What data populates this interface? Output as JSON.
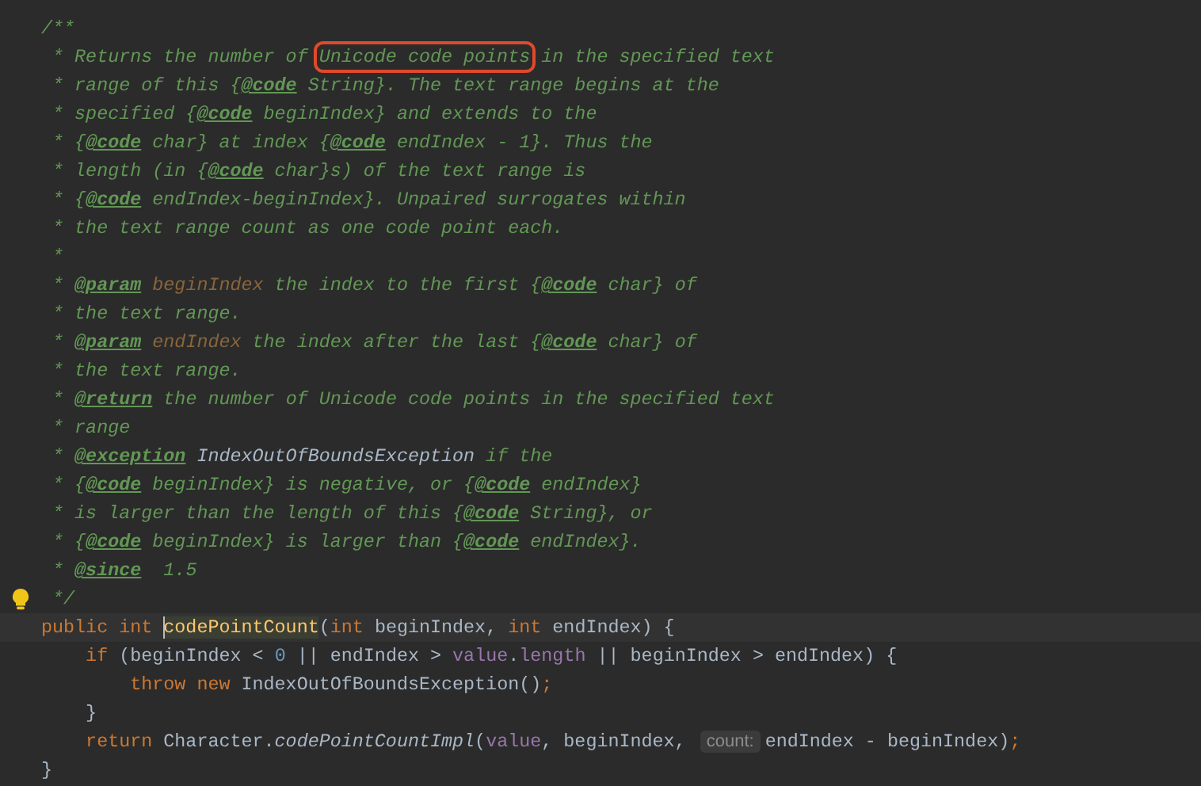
{
  "editor": {
    "lines": [
      {
        "tokens": [
          {
            "kind": "comment",
            "text": "/**"
          }
        ]
      },
      {
        "tokens": [
          {
            "kind": "comment",
            "text": " * Returns the number of "
          },
          {
            "kind": "comment",
            "text": "Unicode code points",
            "boxed": true
          },
          {
            "kind": "comment",
            "text": " in the specified text"
          }
        ]
      },
      {
        "tokens": [
          {
            "kind": "comment",
            "text": " * range of this {"
          },
          {
            "kind": "tag",
            "text": "@code"
          },
          {
            "kind": "comment",
            "text": " String}. The text range begins at the"
          }
        ]
      },
      {
        "tokens": [
          {
            "kind": "comment",
            "text": " * specified {"
          },
          {
            "kind": "tag",
            "text": "@code"
          },
          {
            "kind": "comment",
            "text": " beginIndex} and extends to the"
          }
        ]
      },
      {
        "tokens": [
          {
            "kind": "comment",
            "text": " * {"
          },
          {
            "kind": "tag",
            "text": "@code"
          },
          {
            "kind": "comment",
            "text": " char} at index {"
          },
          {
            "kind": "tag",
            "text": "@code"
          },
          {
            "kind": "comment",
            "text": " endIndex - 1}. Thus the"
          }
        ]
      },
      {
        "tokens": [
          {
            "kind": "comment",
            "text": " * length (in {"
          },
          {
            "kind": "tag",
            "text": "@code"
          },
          {
            "kind": "comment",
            "text": " char}s) of the text range is"
          }
        ]
      },
      {
        "tokens": [
          {
            "kind": "comment",
            "text": " * {"
          },
          {
            "kind": "tag",
            "text": "@code"
          },
          {
            "kind": "comment",
            "text": " endIndex-beginIndex}. Unpaired surrogates within"
          }
        ]
      },
      {
        "tokens": [
          {
            "kind": "comment",
            "text": " * the text range count as one code point each."
          }
        ]
      },
      {
        "tokens": [
          {
            "kind": "comment",
            "text": " *"
          }
        ]
      },
      {
        "tokens": [
          {
            "kind": "comment",
            "text": " * "
          },
          {
            "kind": "tag",
            "text": "@param"
          },
          {
            "kind": "docparam",
            "text": " beginIndex"
          },
          {
            "kind": "comment",
            "text": " the index to the first {"
          },
          {
            "kind": "tag",
            "text": "@code"
          },
          {
            "kind": "comment",
            "text": " char} of"
          }
        ]
      },
      {
        "tokens": [
          {
            "kind": "comment",
            "text": " * the text range."
          }
        ]
      },
      {
        "tokens": [
          {
            "kind": "comment",
            "text": " * "
          },
          {
            "kind": "tag",
            "text": "@param"
          },
          {
            "kind": "docparam",
            "text": " endIndex"
          },
          {
            "kind": "comment",
            "text": " the index after the last {"
          },
          {
            "kind": "tag",
            "text": "@code"
          },
          {
            "kind": "comment",
            "text": " char} of"
          }
        ]
      },
      {
        "tokens": [
          {
            "kind": "comment",
            "text": " * the text range."
          }
        ]
      },
      {
        "tokens": [
          {
            "kind": "comment",
            "text": " * "
          },
          {
            "kind": "tag",
            "text": "@return"
          },
          {
            "kind": "comment",
            "text": " the number of Unicode code points in the specified text"
          }
        ]
      },
      {
        "tokens": [
          {
            "kind": "comment",
            "text": " * range"
          }
        ]
      },
      {
        "tokens": [
          {
            "kind": "comment",
            "text": " * "
          },
          {
            "kind": "tag",
            "text": "@exception"
          },
          {
            "kind": "docref",
            "text": " IndexOutOfBoundsException"
          },
          {
            "kind": "comment",
            "text": " if the"
          }
        ]
      },
      {
        "tokens": [
          {
            "kind": "comment",
            "text": " * {"
          },
          {
            "kind": "tag",
            "text": "@code"
          },
          {
            "kind": "comment",
            "text": " beginIndex} is negative, or {"
          },
          {
            "kind": "tag",
            "text": "@code"
          },
          {
            "kind": "comment",
            "text": " endIndex}"
          }
        ]
      },
      {
        "tokens": [
          {
            "kind": "comment",
            "text": " * is larger than the length of this {"
          },
          {
            "kind": "tag",
            "text": "@code"
          },
          {
            "kind": "comment",
            "text": " String}, or"
          }
        ]
      },
      {
        "tokens": [
          {
            "kind": "comment",
            "text": " * {"
          },
          {
            "kind": "tag",
            "text": "@code"
          },
          {
            "kind": "comment",
            "text": " beginIndex} is larger than {"
          },
          {
            "kind": "tag",
            "text": "@code"
          },
          {
            "kind": "comment",
            "text": " endIndex}."
          }
        ]
      },
      {
        "tokens": [
          {
            "kind": "comment",
            "text": " * "
          },
          {
            "kind": "tag",
            "text": "@since"
          },
          {
            "kind": "comment",
            "text": "  1.5"
          }
        ]
      },
      {
        "bulb": true,
        "tokens": [
          {
            "kind": "comment",
            "text": " */"
          }
        ]
      },
      {
        "current": true,
        "tokens": [
          {
            "kind": "keyword",
            "text": "public int "
          },
          {
            "kind": "declaration",
            "text": "codePointCount",
            "caret": true
          },
          {
            "kind": "plain",
            "text": "("
          },
          {
            "kind": "keyword",
            "text": "int "
          },
          {
            "kind": "plain",
            "text": "beginIndex, "
          },
          {
            "kind": "keyword",
            "text": "int "
          },
          {
            "kind": "plain",
            "text": "endIndex) {"
          }
        ]
      },
      {
        "tokens": [
          {
            "kind": "keyword",
            "text": "    if"
          },
          {
            "kind": "plain",
            "text": " (beginIndex < "
          },
          {
            "kind": "number",
            "text": "0"
          },
          {
            "kind": "plain",
            "text": " || endIndex > "
          },
          {
            "kind": "field",
            "text": "value"
          },
          {
            "kind": "plain",
            "text": "."
          },
          {
            "kind": "field",
            "text": "length"
          },
          {
            "kind": "plain",
            "text": " || beginIndex > endIndex) {"
          }
        ]
      },
      {
        "tokens": [
          {
            "kind": "keyword",
            "text": "        throw new "
          },
          {
            "kind": "plain",
            "text": "IndexOutOfBoundsException()"
          },
          {
            "kind": "keyword",
            "text": ";"
          }
        ]
      },
      {
        "tokens": [
          {
            "kind": "plain",
            "text": "    }"
          }
        ]
      },
      {
        "tokens": [
          {
            "kind": "keyword",
            "text": "    return "
          },
          {
            "kind": "plain",
            "text": "Character."
          },
          {
            "kind": "static",
            "text": "codePointCountImpl"
          },
          {
            "kind": "plain",
            "text": "("
          },
          {
            "kind": "field",
            "text": "value"
          },
          {
            "kind": "plain",
            "text": ", beginIndex, "
          },
          {
            "kind": "hint",
            "text": "count:"
          },
          {
            "kind": "plain",
            "text": "endIndex - beginIndex)"
          },
          {
            "kind": "keyword",
            "text": ";"
          }
        ]
      },
      {
        "tokens": [
          {
            "kind": "plain",
            "text": "}"
          }
        ]
      }
    ]
  }
}
